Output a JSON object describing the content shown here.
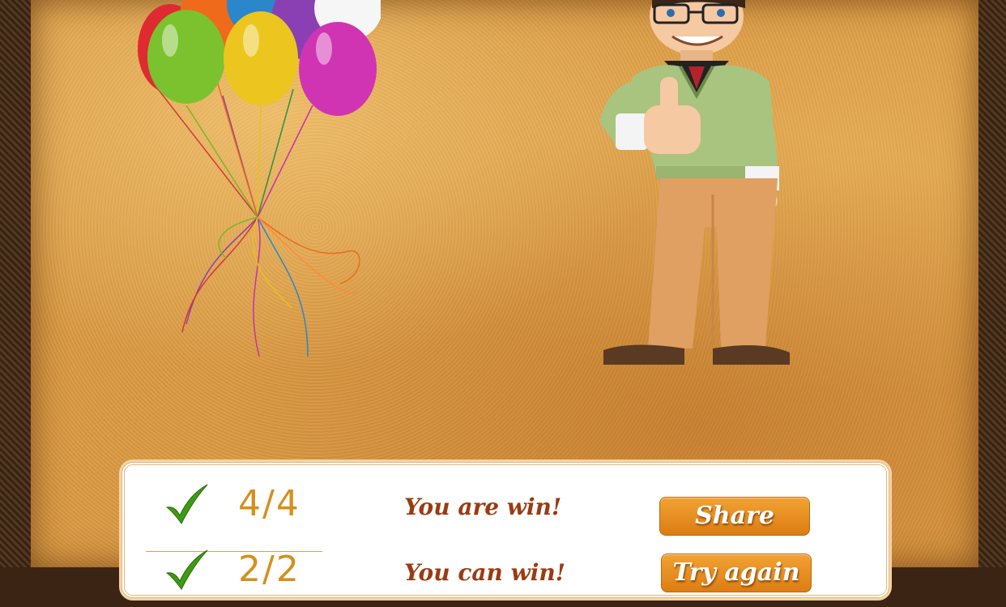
{
  "results": [
    {
      "score": "4/4",
      "message": "You are win!",
      "button": "Share",
      "icon": "checkmark-icon"
    },
    {
      "score": "2/2",
      "message": "You can win!",
      "button": "Try again",
      "icon": "checkmark-icon"
    }
  ],
  "colors": {
    "parchment": "#d99a45",
    "frame": "#4a2e17",
    "button": "#e88c1c",
    "score_text": "#d4901e",
    "message_text": "#9a3b12",
    "check_green": "#3e9b12"
  },
  "illustrations": [
    "balloons-illustration",
    "character-thumbs-up-illustration"
  ]
}
